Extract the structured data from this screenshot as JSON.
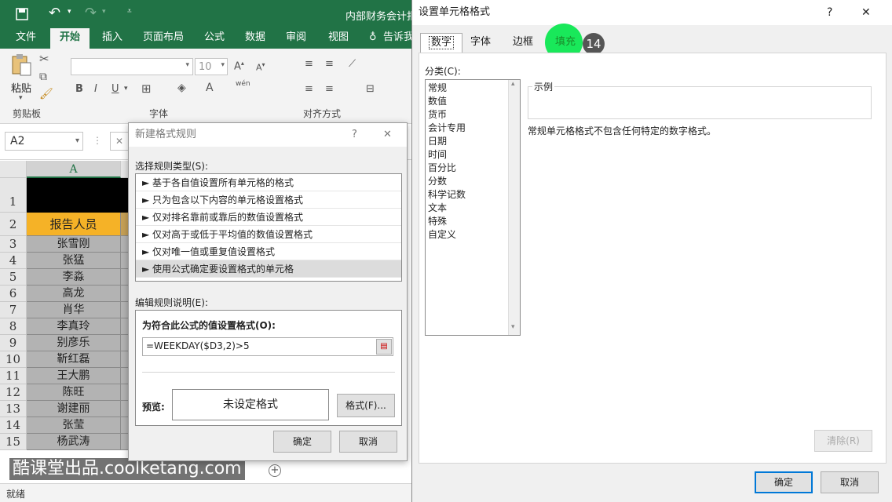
{
  "excel": {
    "title": "内部财务会计报",
    "tabs": [
      "文件",
      "开始",
      "插入",
      "页面布局",
      "公式",
      "数据",
      "审阅",
      "视图",
      "告诉我"
    ],
    "active_tab": "开始",
    "ribbon": {
      "paste_label": "粘贴",
      "clipboard_group": "剪贴板",
      "font_group": "字体",
      "align_group": "对齐方式",
      "font_size": "10",
      "bold": "B",
      "italic": "I",
      "underline": "U",
      "wen": "wén"
    },
    "name_box": "A2",
    "col_a": "A",
    "row1_num": "1",
    "header_cell": "报告人员",
    "rows": [
      {
        "num": "2",
        "name": "报告人员"
      },
      {
        "num": "3",
        "name": "张雪刚"
      },
      {
        "num": "4",
        "name": "张猛"
      },
      {
        "num": "5",
        "name": "李淼"
      },
      {
        "num": "6",
        "name": "高龙"
      },
      {
        "num": "7",
        "name": "肖华"
      },
      {
        "num": "8",
        "name": "李真玲"
      },
      {
        "num": "9",
        "name": "别彦乐"
      },
      {
        "num": "10",
        "name": "靳红磊"
      },
      {
        "num": "11",
        "name": "王大鹏"
      },
      {
        "num": "12",
        "name": "陈旺"
      },
      {
        "num": "13",
        "name": "谢建丽"
      },
      {
        "num": "14",
        "name": "张莹"
      },
      {
        "num": "15",
        "name": "杨武涛"
      }
    ],
    "status": "就绪",
    "watermark": "酷课堂出品.coolketang.com"
  },
  "rule_dialog": {
    "title": "新建格式规则",
    "help": "?",
    "close": "✕",
    "select_type_label": "选择规则类型(S):",
    "rule_types": [
      "► 基于各自值设置所有单元格的格式",
      "► 只为包含以下内容的单元格设置格式",
      "► 仅对排名靠前或靠后的数值设置格式",
      "► 仅对高于或低于平均值的数值设置格式",
      "► 仅对唯一值或重复值设置格式",
      "► 使用公式确定要设置格式的单元格"
    ],
    "edit_label": "编辑规则说明(E):",
    "formula_label": "为符合此公式的值设置格式(O):",
    "formula": "=WEEKDAY($D3,2)>5",
    "preview_label": "预览:",
    "preview_text": "未设定格式",
    "format_button": "格式(F)...",
    "ok": "确定",
    "cancel": "取消"
  },
  "format_dialog": {
    "title": "设置单元格格式",
    "help": "?",
    "close": "✕",
    "tabs": [
      "数字",
      "字体",
      "边框",
      "填充"
    ],
    "step_badge": "14",
    "category_label": "分类(C):",
    "categories": [
      "常规",
      "数值",
      "货币",
      "会计专用",
      "日期",
      "时间",
      "百分比",
      "分数",
      "科学记数",
      "文本",
      "特殊",
      "自定义"
    ],
    "sample_label": "示例",
    "description": "常规单元格格式不包含任何特定的数字格式。",
    "clear_button": "清除(R)",
    "ok": "确定",
    "cancel": "取消"
  },
  "colors": {
    "excel_green": "#217346",
    "header_orange": "#f5b227",
    "highlight_green": "#19e85a"
  }
}
